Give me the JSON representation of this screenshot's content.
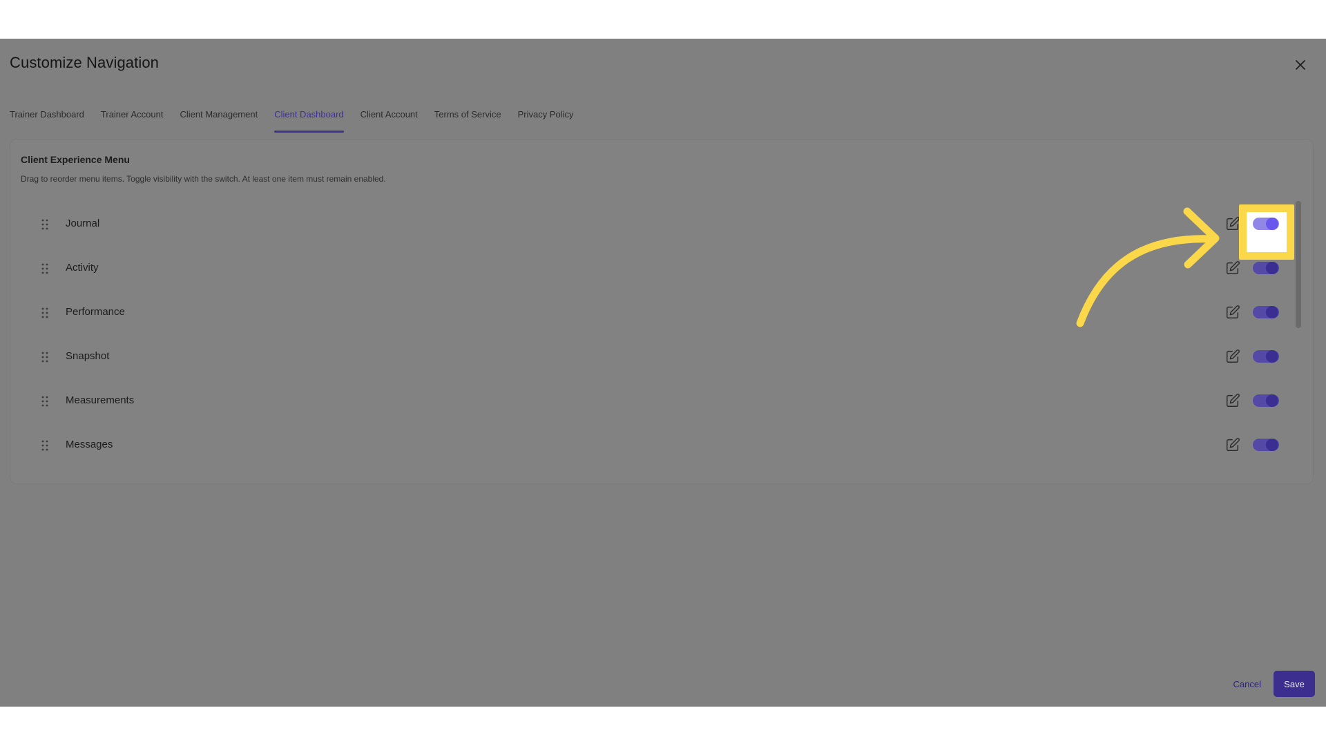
{
  "dialog": {
    "title": "Customize Navigation"
  },
  "tabs": [
    {
      "label": "Trainer Dashboard",
      "active": false
    },
    {
      "label": "Trainer Account",
      "active": false
    },
    {
      "label": "Client Management",
      "active": false
    },
    {
      "label": "Client Dashboard",
      "active": true
    },
    {
      "label": "Client Account",
      "active": false
    },
    {
      "label": "Terms of Service",
      "active": false
    },
    {
      "label": "Privacy Policy",
      "active": false
    }
  ],
  "panel": {
    "title": "Client Experience Menu",
    "description": "Drag to reorder menu items. Toggle visibility with the switch. At least one item must remain enabled.",
    "items": [
      {
        "label": "Journal",
        "enabled": true,
        "highlighted": true
      },
      {
        "label": "Activity",
        "enabled": true,
        "highlighted": false
      },
      {
        "label": "Performance",
        "enabled": true,
        "highlighted": false
      },
      {
        "label": "Snapshot",
        "enabled": true,
        "highlighted": false
      },
      {
        "label": "Measurements",
        "enabled": true,
        "highlighted": false
      },
      {
        "label": "Messages",
        "enabled": true,
        "highlighted": false
      }
    ]
  },
  "footer": {
    "cancel_label": "Cancel",
    "save_label": "Save"
  },
  "colors": {
    "accent": "#3b2e8f",
    "highlight": "#fbd74a",
    "overlay": "#808080"
  },
  "icons": {
    "close": "close-icon",
    "drag": "drag-handle-icon",
    "edit": "edit-icon",
    "annotation": "curved-arrow-icon"
  }
}
